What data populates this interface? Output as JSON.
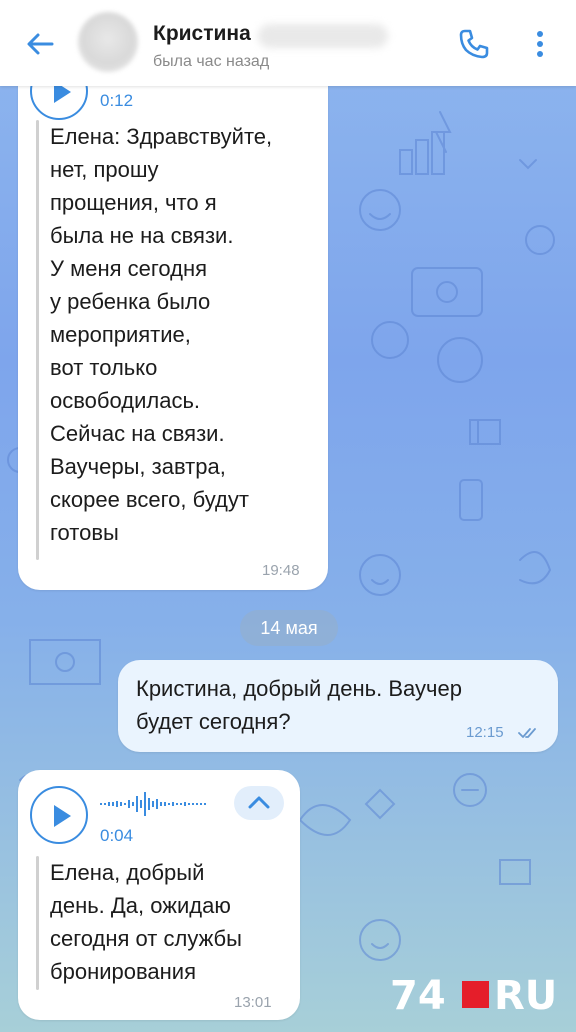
{
  "header": {
    "contact_name": "Кристина",
    "status": "была час назад"
  },
  "messages": [
    {
      "direction": "incoming",
      "voice_duration": "0:12",
      "lines": [
        "Елена: Здравствуйте,",
        "нет, прошу",
        "прощения, что я",
        "была не на связи.",
        "У меня сегодня",
        "у ребенка было",
        "мероприятие,",
        "вот только",
        "освободилась.",
        "Сейчас на связи.",
        "Ваучеры, завтра,",
        "скорее всего, будут",
        "готовы"
      ],
      "time": "19:48"
    },
    {
      "direction": "outgoing",
      "lines": [
        "Кристина, добрый день. Ваучер",
        "будет сегодня?"
      ],
      "time": "12:15",
      "read": true
    },
    {
      "direction": "incoming",
      "voice_duration": "0:04",
      "lines": [
        "Елена, добрый",
        "день. Да, ожидаю",
        "сегодня от службы",
        "бронирования"
      ],
      "time": "13:01"
    }
  ],
  "date_separator": "14 мая",
  "watermark": {
    "number": "74",
    "suffix": "RU",
    "square_color": "#e51e2a"
  },
  "colors": {
    "accent": "#3a8ce0",
    "background": "#86ace9"
  },
  "icons": [
    "back-arrow-icon",
    "phone-icon",
    "more-vertical-icon",
    "play-icon",
    "waveform-icon",
    "chevron-up-icon",
    "double-check-icon"
  ]
}
